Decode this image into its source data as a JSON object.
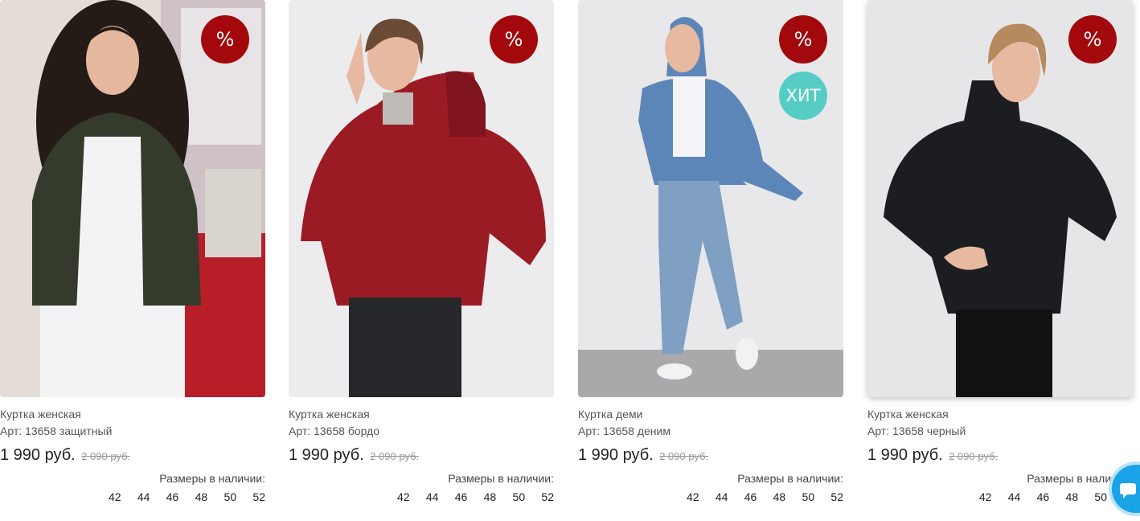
{
  "products": [
    {
      "name": "Куртка женская",
      "article": "Арт: 13658 защитный",
      "price": "1 990 руб.",
      "old_price": "2 090 руб.",
      "badges": [
        "%"
      ],
      "sizes_title": "Размеры в наличии:",
      "sizes": [
        "42",
        "44",
        "46",
        "48",
        "50",
        "52"
      ],
      "jacket_color": "#343a2c"
    },
    {
      "name": "Куртка женская",
      "article": "Арт: 13658 бордо",
      "price": "1 990 руб.",
      "old_price": "2 090 руб.",
      "badges": [
        "%"
      ],
      "sizes_title": "Размеры в наличии:",
      "sizes": [
        "42",
        "44",
        "46",
        "48",
        "50",
        "52"
      ],
      "jacket_color": "#9b1b25"
    },
    {
      "name": "Куртка деми",
      "article": "Арт: 13658 деним",
      "price": "1 990 руб.",
      "old_price": "2 090 руб.",
      "badges": [
        "%",
        "ХИТ"
      ],
      "sizes_title": "Размеры в наличии:",
      "sizes": [
        "42",
        "44",
        "46",
        "48",
        "50",
        "52"
      ],
      "jacket_color": "#5d86b8"
    },
    {
      "name": "Куртка женская",
      "article": "Арт: 13658 черный",
      "price": "1 990 руб.",
      "old_price": "2 090 руб.",
      "badges": [
        "%"
      ],
      "sizes_title": "Размеры в наличии:",
      "sizes": [
        "42",
        "44",
        "46",
        "48",
        "50"
      ],
      "jacket_color": "#1c1d20"
    }
  ],
  "colors": {
    "sale_badge": "#a3090c",
    "hit_badge": "#56cdc4",
    "chat_widget": "#1aa3e6"
  },
  "chat_widget_icon": "chat-bubble-icon"
}
